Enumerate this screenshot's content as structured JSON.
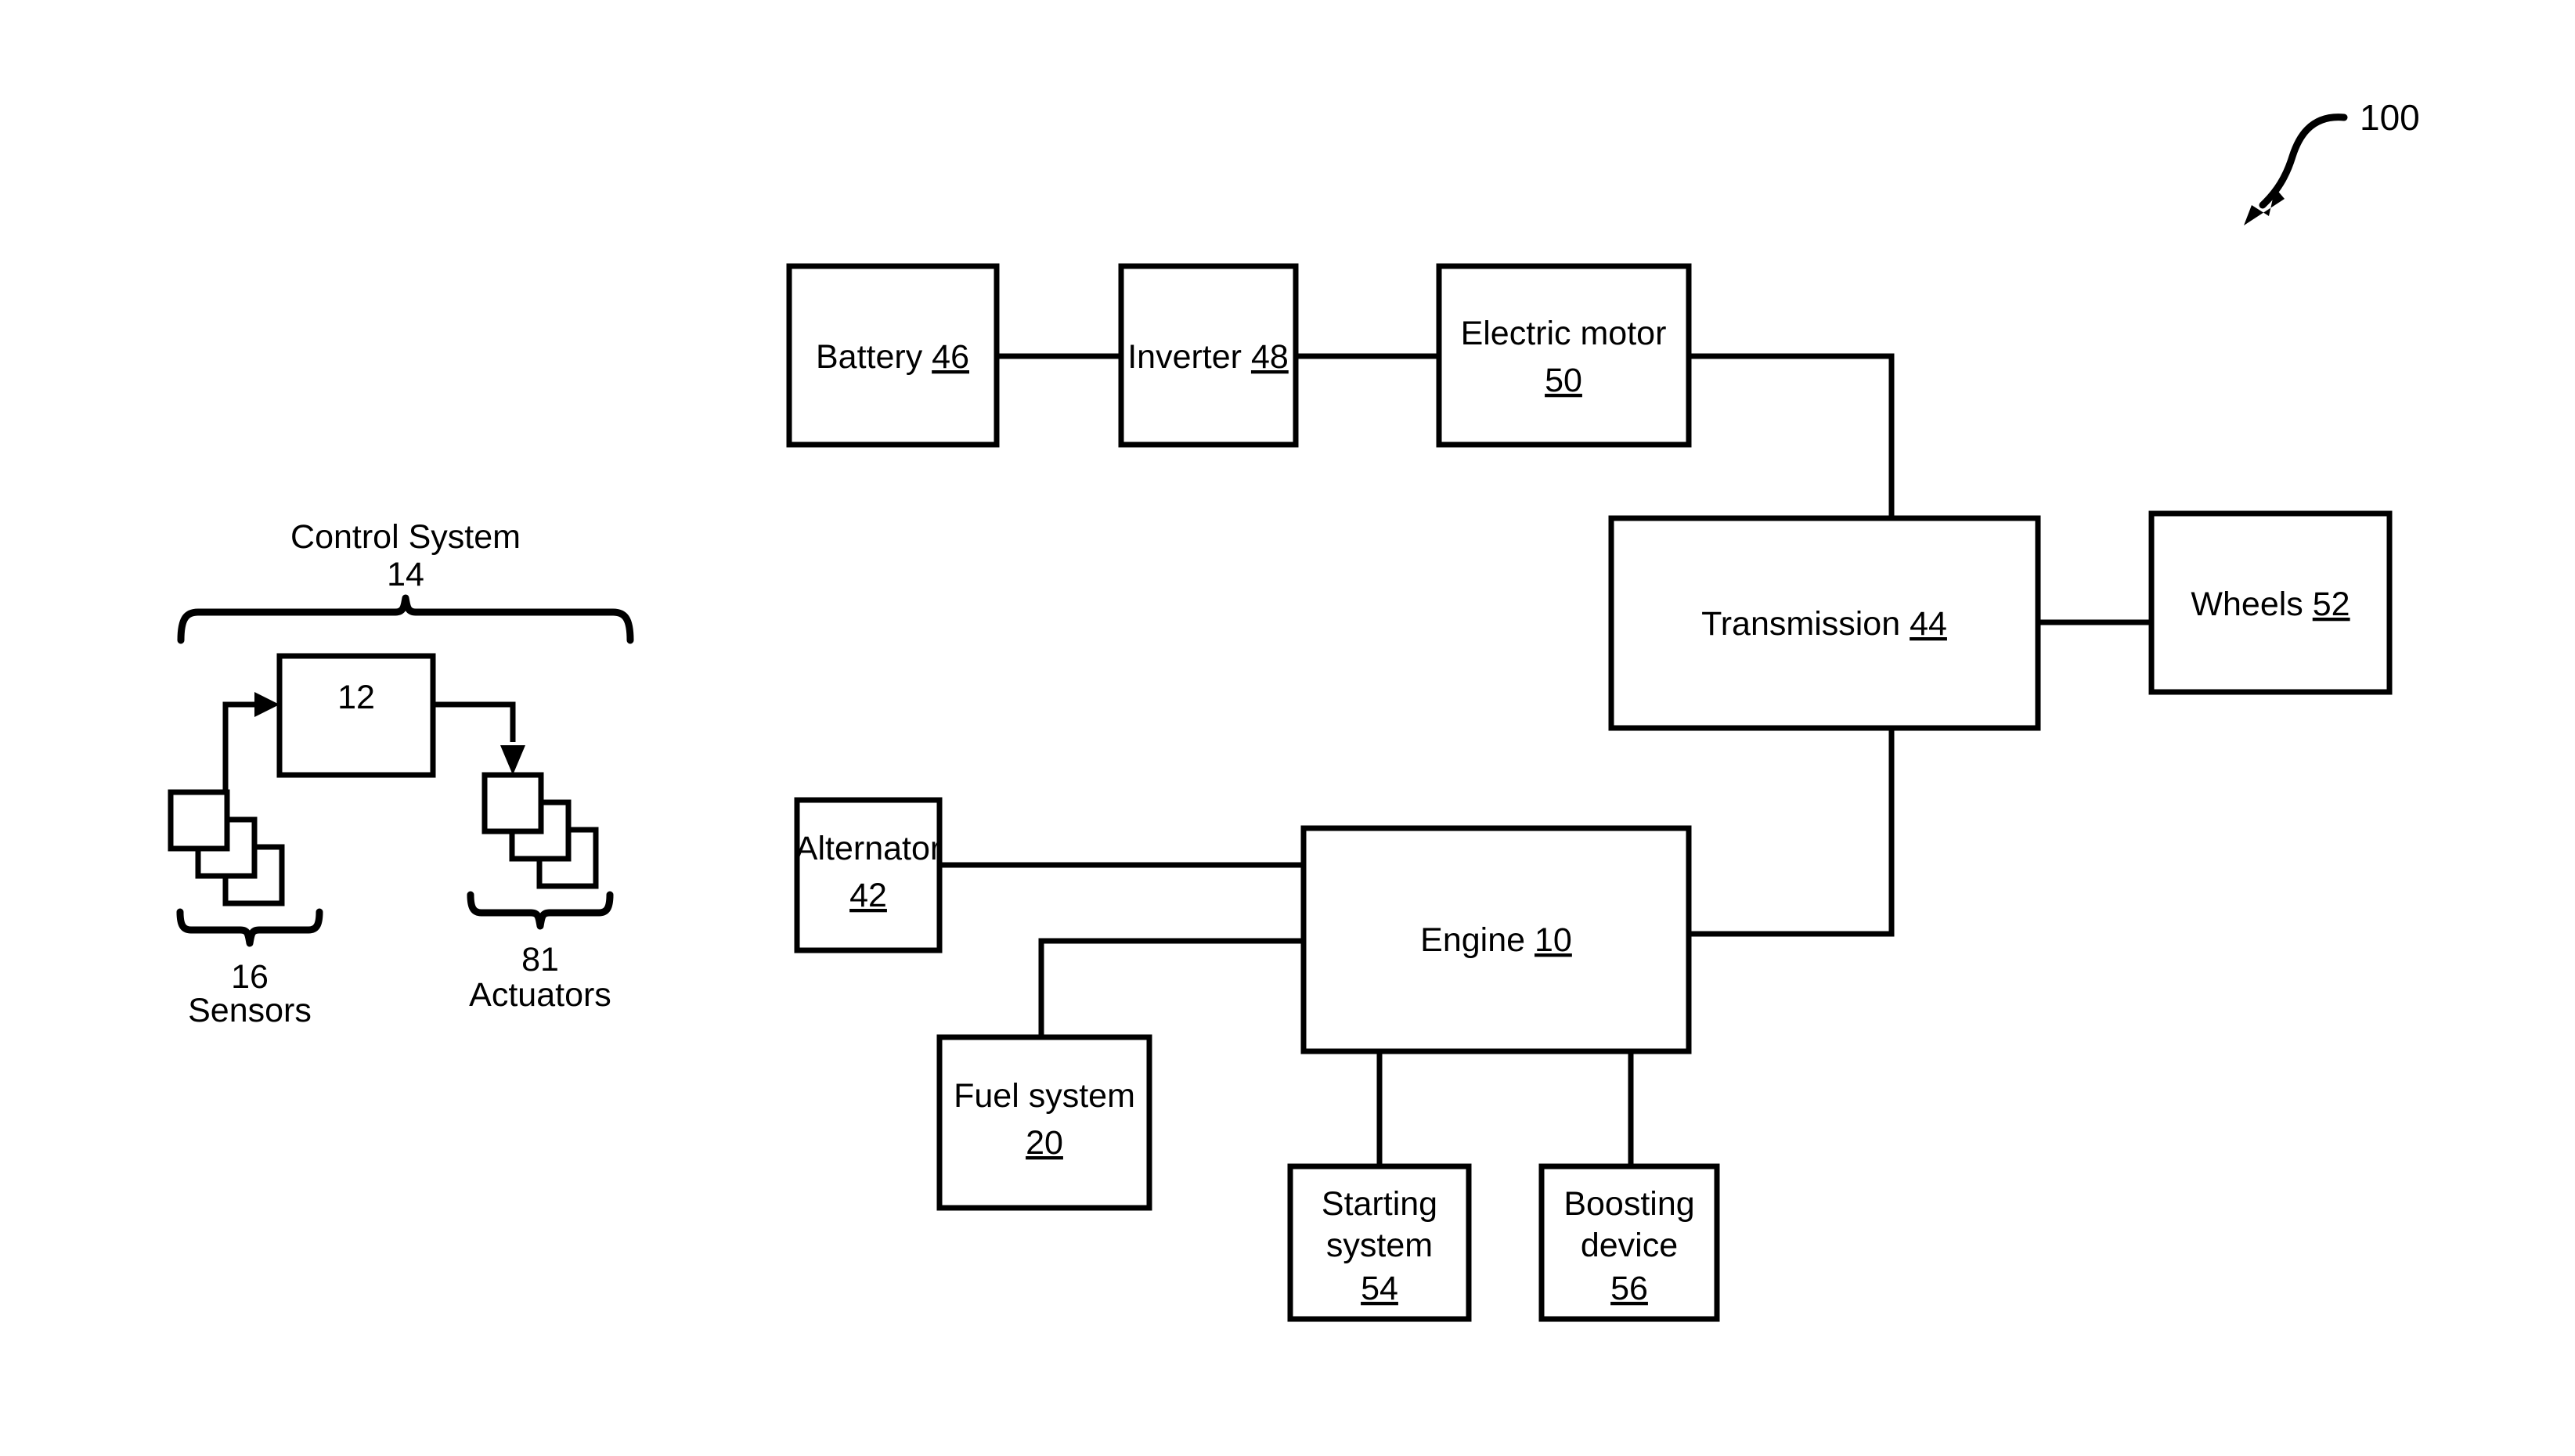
{
  "figure": {
    "reference_number": "100",
    "pointer_icon": "curved-arrow-icon"
  },
  "control_system": {
    "title": "Control System",
    "title_ref": "14",
    "controller_ref": "12",
    "sensors": {
      "ref": "16",
      "label": "Sensors",
      "stack_count": 3
    },
    "actuators": {
      "ref": "81",
      "label": "Actuators",
      "stack_count": 3
    }
  },
  "blocks": {
    "battery": {
      "label": "Battery",
      "ref": "46"
    },
    "inverter": {
      "label": "Inverter",
      "ref": "48"
    },
    "electric_motor": {
      "label": "Electric motor",
      "ref": "50"
    },
    "transmission": {
      "label": "Transmission",
      "ref": "44"
    },
    "wheels": {
      "label": "Wheels",
      "ref": "52"
    },
    "alternator": {
      "label": "Alternator",
      "ref": "42"
    },
    "engine": {
      "label": "Engine",
      "ref": "10"
    },
    "fuel_system": {
      "label": "Fuel system",
      "ref": "20"
    },
    "starting_system": {
      "label_line1": "Starting",
      "label_line2": "system",
      "ref": "54"
    },
    "boosting_device": {
      "label_line1": "Boosting",
      "label_line2": "device",
      "ref": "56"
    }
  },
  "style": {
    "ink": "#000000",
    "paper": "#ffffff"
  }
}
